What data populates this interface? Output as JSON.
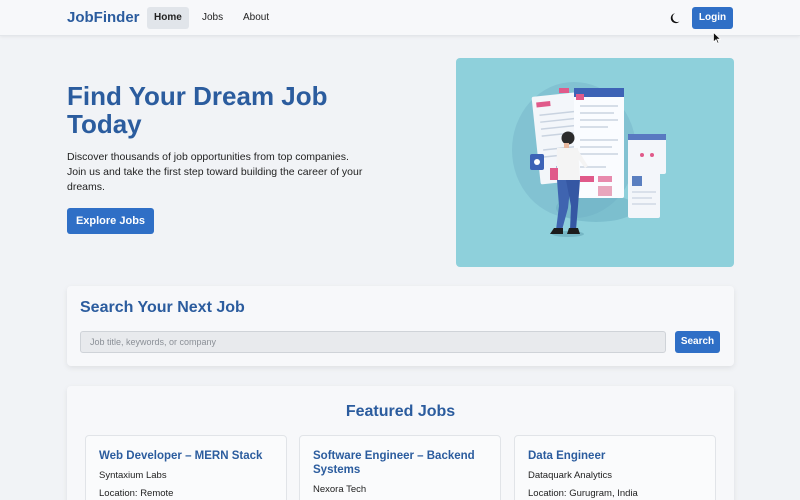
{
  "nav": {
    "brand": "JobFinder",
    "links": [
      {
        "label": "Home",
        "active": true
      },
      {
        "label": "Jobs",
        "active": false
      },
      {
        "label": "About",
        "active": false
      }
    ],
    "theme_icon": "moon-icon",
    "login_label": "Login"
  },
  "hero": {
    "title": "Find Your Dream Job Today",
    "description": "Discover thousands of job opportunities from top companies. Join us and take the first step toward building the career of your dreams.",
    "cta_label": "Explore Jobs",
    "illustration": "job-search-illustration"
  },
  "search": {
    "title": "Search Your Next Job",
    "placeholder": "Job title, keywords, or company",
    "button_label": "Search"
  },
  "featured": {
    "title": "Featured Jobs",
    "jobs": [
      {
        "title": "Web Developer – MERN Stack",
        "company": "Syntaxium Labs",
        "location": "Location: Remote"
      },
      {
        "title": "Software Engineer – Backend Systems",
        "company": "Nexora Tech",
        "location": ""
      },
      {
        "title": "Data Engineer",
        "company": "Dataquark Analytics",
        "location": "Location: Gurugram, India"
      }
    ]
  },
  "colors": {
    "brand": "#2b5c9e",
    "primary_button": "#2f6fc6",
    "hero_image_bg": "#8ed0db",
    "page_bg": "#f1f3f6"
  }
}
